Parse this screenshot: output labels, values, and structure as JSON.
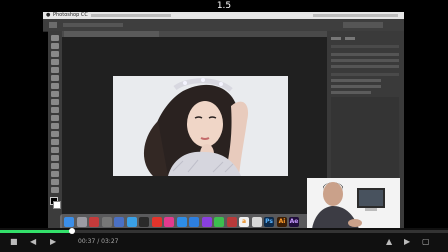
{
  "player": {
    "title": "1.5",
    "time_current": "00:37",
    "time_total": "03:27",
    "progress_fraction": 0.16,
    "accent_color": "#33e06a"
  },
  "mac_menu": {
    "app_name": "Photoshop CC"
  },
  "photoshop": {
    "document_tab": "",
    "canvas_watermark": ""
  },
  "dock": {
    "icons": [
      {
        "name": "finder-icon",
        "color": "#3b8ee8",
        "label": ""
      },
      {
        "name": "launchpad-icon",
        "color": "#9b9ba3",
        "label": ""
      },
      {
        "name": "rocket-icon",
        "color": "#c43b3b",
        "label": ""
      },
      {
        "name": "system-prefs-icon",
        "color": "#777777",
        "label": ""
      },
      {
        "name": "mission-control-icon",
        "color": "#4a70c4",
        "label": ""
      },
      {
        "name": "safari-icon",
        "color": "#3aa0e6",
        "label": ""
      },
      {
        "name": "dashboard-icon",
        "color": "#2a2a2a",
        "label": ""
      },
      {
        "name": "weibo-icon",
        "color": "#e2342c",
        "label": ""
      },
      {
        "name": "itunes-icon",
        "color": "#e23a8e",
        "label": ""
      },
      {
        "name": "qq-icon",
        "color": "#2e8de6",
        "label": ""
      },
      {
        "name": "app-store-icon",
        "color": "#2d7fe0",
        "label": ""
      },
      {
        "name": "game-center-icon",
        "color": "#8a3fe0",
        "label": ""
      },
      {
        "name": "wechat-icon",
        "color": "#3cbe4f",
        "label": ""
      },
      {
        "name": "photo-booth-icon",
        "color": "#b83a3a",
        "label": ""
      },
      {
        "name": "amazon-icon",
        "color": "#f0f0f0",
        "label": "a"
      },
      {
        "name": "file-icon",
        "color": "#d9d9d9",
        "label": ""
      },
      {
        "name": "photoshop-icon",
        "color": "#0d2a4a",
        "label": "Ps"
      },
      {
        "name": "illustrator-icon",
        "color": "#3a1e07",
        "label": "Ai"
      },
      {
        "name": "after-effects-icon",
        "color": "#1f0d3a",
        "label": "Ae"
      }
    ]
  },
  "controls": {
    "stop_icon": "stop-icon",
    "prev_icon": "previous-icon",
    "play_icon": "play-icon",
    "next_icon": "next-icon",
    "volume_icon": "volume-icon",
    "fullscreen_icon": "fullscreen-icon"
  }
}
